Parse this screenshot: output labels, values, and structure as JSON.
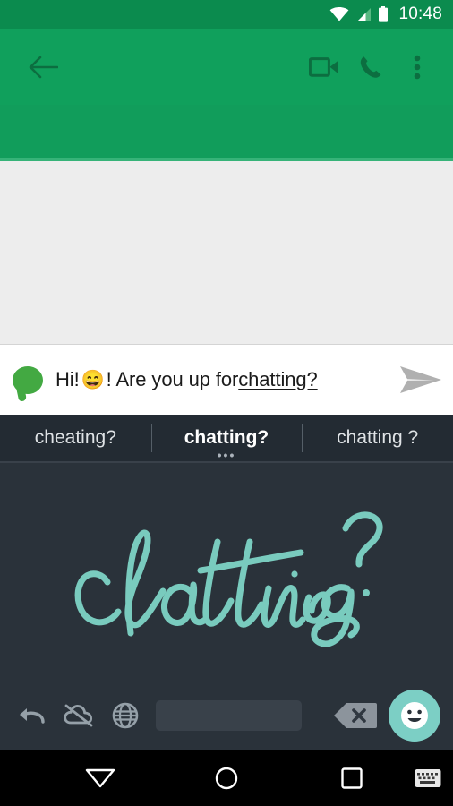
{
  "status_bar": {
    "time": "10:48",
    "icons": [
      "wifi-icon",
      "signal-icon",
      "battery-icon"
    ]
  },
  "app_bar": {
    "back_label": "back-arrow",
    "actions": [
      {
        "name": "video-call-icon",
        "label": "Video call"
      },
      {
        "name": "phone-call-icon",
        "label": "Call"
      },
      {
        "name": "overflow-menu-icon",
        "label": "More options"
      }
    ],
    "accent_color": "#10a05c",
    "icon_color": "#0d6b3f"
  },
  "compose": {
    "bubble_icon": "chat-bubble-icon",
    "bubble_color": "#43a942",
    "text_before": "Hi! ",
    "emoji": "😄",
    "text_middle": "! Are you up for ",
    "text_underlined": "chatting?",
    "full_text": "Hi! 😄! Are you up for chatting?",
    "send_icon": "send-icon",
    "send_color": "#aaaaaa"
  },
  "suggestions": {
    "items": [
      {
        "label": "cheating?",
        "selected": false
      },
      {
        "label": "chatting?",
        "selected": true,
        "more_dots": "•••"
      },
      {
        "label": "chatting ?",
        "selected": false
      }
    ],
    "bar_color": "#232b33"
  },
  "handwriting": {
    "recognized_word": "chatting?",
    "ink_color": "#79cbbe",
    "canvas_color": "#2a323a"
  },
  "keyboard_toolbar": {
    "buttons": [
      {
        "name": "undo-icon",
        "label": "Undo"
      },
      {
        "name": "cloud-off-icon",
        "label": "Offline"
      },
      {
        "name": "globe-language-icon",
        "label": "Change language"
      },
      {
        "name": "space-bar",
        "label": "Space"
      },
      {
        "name": "backspace-icon",
        "label": "Delete"
      },
      {
        "name": "emoji-icon",
        "label": "Emoji"
      }
    ],
    "emoji_button_color": "#7ccfc5",
    "backspace_color": "#8c949c"
  },
  "nav_bar": {
    "buttons": [
      {
        "name": "nav-back-icon",
        "label": "Back"
      },
      {
        "name": "nav-home-icon",
        "label": "Home"
      },
      {
        "name": "nav-recents-icon",
        "label": "Recents"
      },
      {
        "name": "nav-keyboard-icon",
        "label": "Keyboard"
      }
    ]
  }
}
